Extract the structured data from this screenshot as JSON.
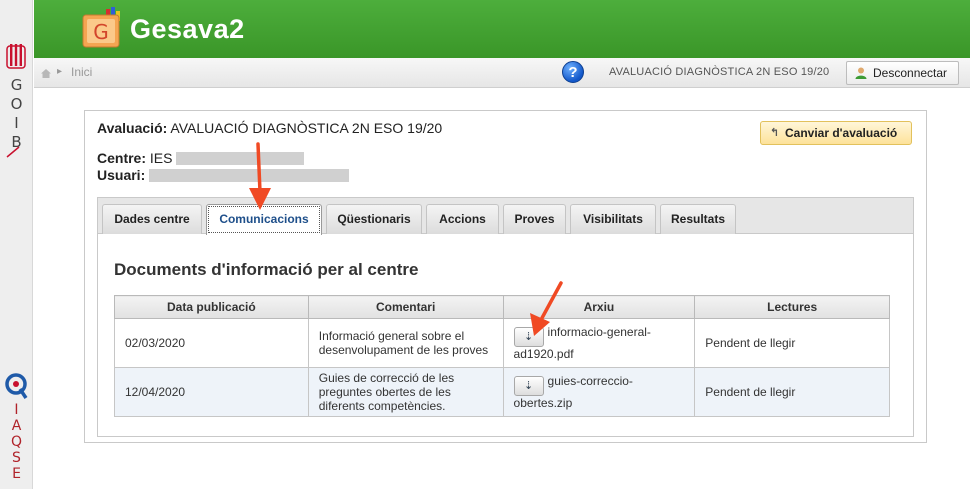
{
  "sidebar": {
    "goib_text": "GOIB",
    "iaqse_text": "IAQSE"
  },
  "header": {
    "logo_letter": "G",
    "app_title": "Gesava2"
  },
  "topbar": {
    "breadcrumb": "Inici",
    "help_label": "?",
    "evaluation": "AVALUACIÓ DIAGNÒSTICA 2N ESO 19/20",
    "logout_label": "Desconnectar"
  },
  "info": {
    "evaluation_label": "Avaluació:",
    "evaluation_value": "AVALUACIÓ DIAGNÒSTICA 2N ESO 19/20",
    "centre_label": "Centre:",
    "centre_value": "IES",
    "user_label": "Usuari:",
    "change_button": "Canviar d'avaluació"
  },
  "tabs": [
    {
      "label": "Dades centre",
      "active": false
    },
    {
      "label": "Comunicacions",
      "active": true
    },
    {
      "label": "Qüestionaris",
      "active": false
    },
    {
      "label": "Accions",
      "active": false
    },
    {
      "label": "Proves",
      "active": false
    },
    {
      "label": "Visibilitats",
      "active": false
    },
    {
      "label": "Resultats",
      "active": false
    }
  ],
  "section_title": "Documents d'informació per al centre",
  "table": {
    "headers": [
      "Data publicació",
      "Comentari",
      "Arxiu",
      "Lectures"
    ],
    "rows": [
      {
        "date": "02/03/2020",
        "comment": "Informació general sobre el desenvolupament de les proves",
        "file_part1": "informacio-general-",
        "file_part2": "ad1920.pdf",
        "status": "Pendent de llegir"
      },
      {
        "date": "12/04/2020",
        "comment": "Guies de correcció de les preguntes obertes de les diferents competències.",
        "file_part1": "guies-correccio-",
        "file_part2": "obertes.zip",
        "status": "Pendent de llegir"
      }
    ]
  },
  "colors": {
    "header_green": "#43a332",
    "annotation_arrow": "#f04a24",
    "active_tab_text": "#1e4f8a"
  }
}
